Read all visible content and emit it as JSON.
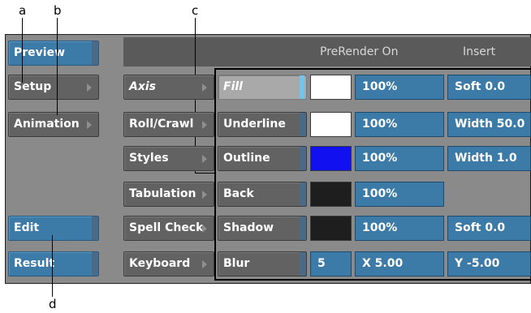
{
  "callouts": {
    "a": "a",
    "b": "b",
    "c": "c",
    "d": "d"
  },
  "header": {
    "prerender": "PreRender On",
    "insert": "Insert"
  },
  "left": {
    "preview": "Preview",
    "setup": "Setup",
    "animation": "Animation",
    "edit": "Edit",
    "result": "Result"
  },
  "categories": [
    "Axis",
    "Roll/Crawl",
    "Styles",
    "Tabulation",
    "Spell Check",
    "Keyboard"
  ],
  "properties": [
    "Fill",
    "Underline",
    "Outline",
    "Back",
    "Shadow",
    "Blur"
  ],
  "colors": {
    "fill": "#ffffff",
    "underline": "#ffffff",
    "outline": "#1010f0",
    "back": "#1e1e1e",
    "shadow": "#1e1e1e"
  },
  "values": {
    "fill_pct": "100%",
    "underline_pct": "100%",
    "outline_pct": "100%",
    "back_pct": "100%",
    "shadow_pct": "100%",
    "blur_val": "5",
    "blur_x": "X 5.00"
  },
  "extras": {
    "fill": "Soft 0.0",
    "underline": "Width 50.0",
    "outline": "Width 1.0",
    "shadow": "Soft 0.0",
    "blur": "Y -5.00"
  }
}
